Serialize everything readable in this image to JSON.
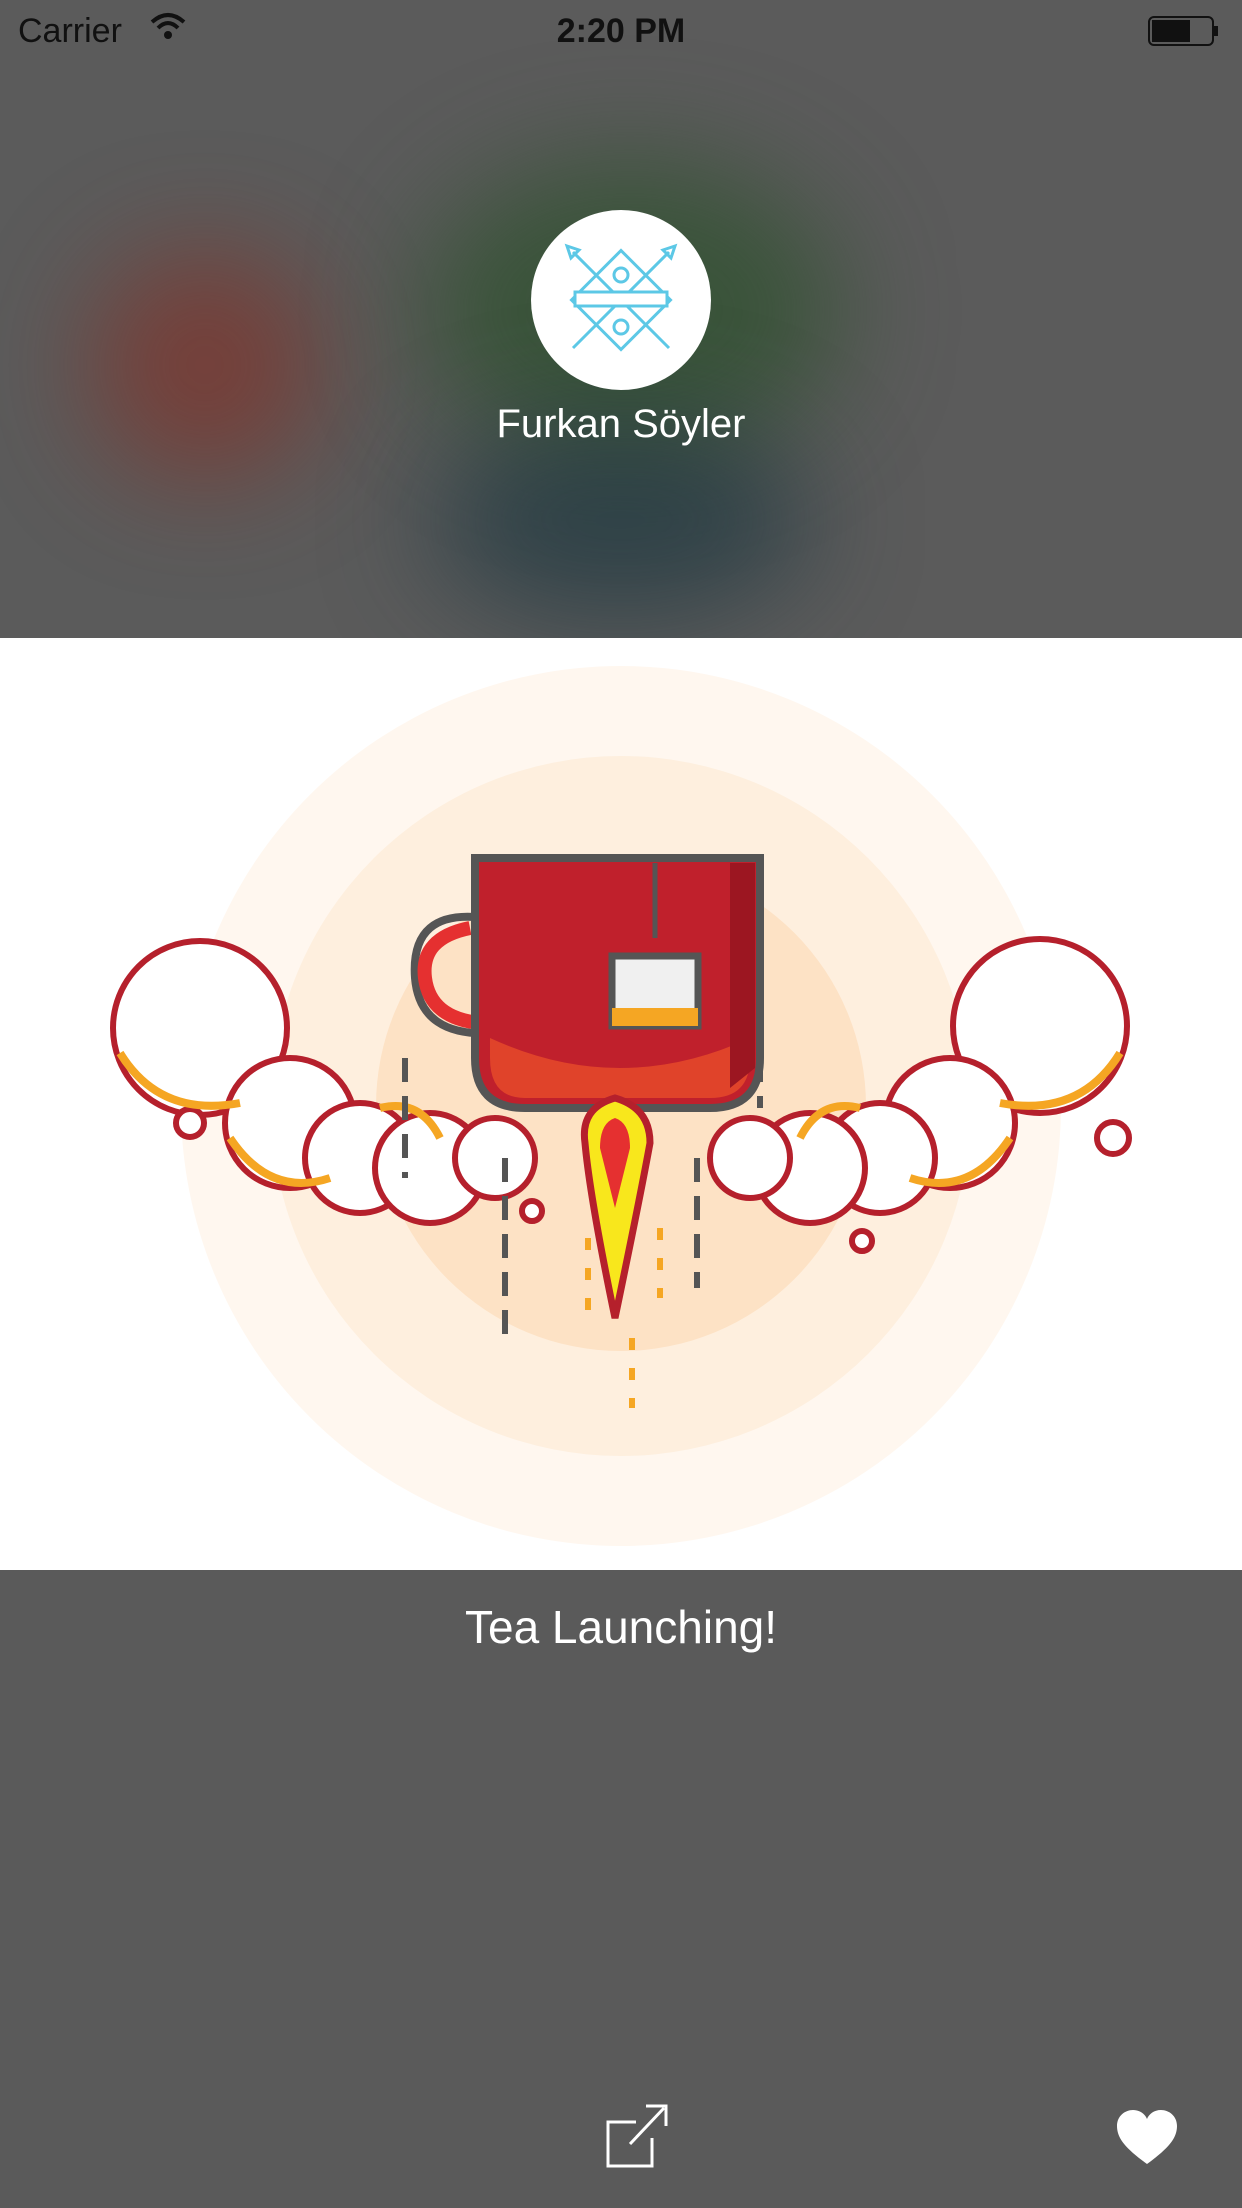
{
  "status_bar": {
    "carrier": "Carrier",
    "time": "2:20 PM"
  },
  "profile": {
    "author_name": "Furkan Söyler",
    "avatar_icon": "illustrator-animator-badge-icon"
  },
  "shot": {
    "title": "Tea Launching!",
    "artwork_icon": "tea-cup-rocket-illustration"
  },
  "toolbar": {
    "share_icon": "share-icon",
    "like_icon": "heart-icon"
  },
  "colors": {
    "background": "#5a5a5a",
    "cup_red": "#c0202c",
    "smoke_orange": "#f5a623",
    "smoke_red": "#b5202c",
    "halo": "#fde2c5",
    "avatar_badge": "#5cc8e6"
  }
}
